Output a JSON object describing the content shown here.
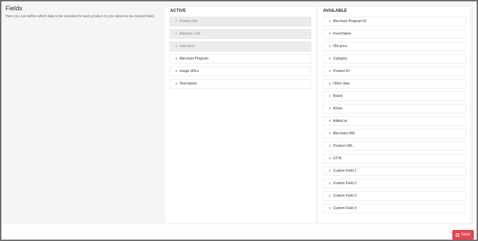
{
  "panel": {
    "title": "Fields",
    "description": "Here you can define which data to be included for each product in your about-to-be-created feed."
  },
  "active": {
    "title": "ACTIVE",
    "items": [
      {
        "label": "Product title",
        "locked": true
      },
      {
        "label": "Marketer Link",
        "locked": true
      },
      {
        "label": "Sale price",
        "locked": true
      },
      {
        "label": "Merchant Program",
        "locked": false
      },
      {
        "label": "Image URLs",
        "locked": false
      },
      {
        "label": "Description",
        "locked": false
      }
    ]
  },
  "available": {
    "title": "AVAILABLE",
    "items": [
      "Merchant Program ID",
      "Feed Name",
      "Old price",
      "Category",
      "Product ID",
      "Other data",
      "Brand",
      "Active",
      "Added at",
      "Merchant URL",
      "Product URL",
      "GTIN",
      "Custom Field 1",
      "Custom Field 2",
      "Custom Field 3",
      "Custom Field 4"
    ]
  },
  "icons": {
    "drag_handle": "drag-handle-icon",
    "save": "floppy-disk-icon"
  },
  "footer": {
    "save_label": "Save"
  },
  "colors": {
    "save_button": "#e8454d",
    "locked_item_bg": "#ececec",
    "panel_bg": "#f4f5f7"
  }
}
